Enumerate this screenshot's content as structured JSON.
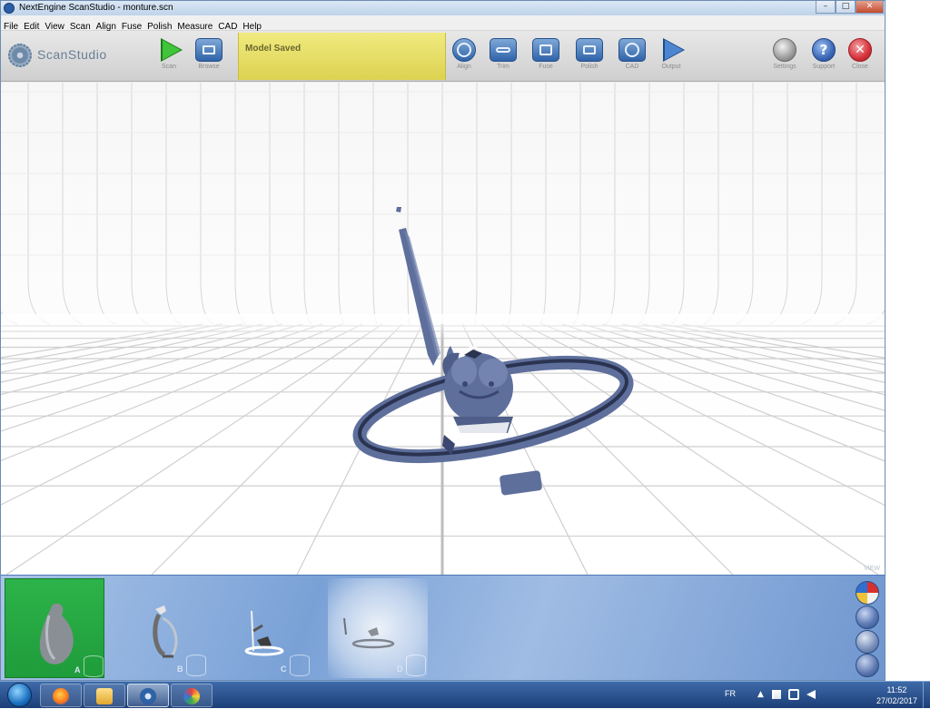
{
  "window": {
    "title": "NextEngine ScanStudio - monture.scn",
    "controls": {
      "minimize": "–",
      "maximize": "□",
      "close": "✕"
    }
  },
  "menubar": {
    "items": [
      "File",
      "Edit",
      "View",
      "Scan",
      "Align",
      "Fuse",
      "Polish",
      "Measure",
      "CAD",
      "Help"
    ]
  },
  "toolbar": {
    "logo_text": "ScanStudio",
    "status_message": "Model Saved",
    "left_buttons": [
      {
        "label": "Scan",
        "icon": "scan-play-icon"
      },
      {
        "label": "Browse",
        "icon": "folder-icon"
      }
    ],
    "mid_buttons": [
      {
        "label": "Align",
        "icon": "align-icon"
      },
      {
        "label": "Trim",
        "icon": "scissors-icon"
      },
      {
        "label": "Fuse",
        "icon": "cube-icon"
      },
      {
        "label": "Polish",
        "icon": "toolbox-icon"
      },
      {
        "label": "CAD",
        "icon": "globe-icon"
      },
      {
        "label": "Output",
        "icon": "output-arrow-icon"
      }
    ],
    "right_buttons": [
      {
        "label": "Settings",
        "icon": "settings-icon",
        "color": "#9b9b9b"
      },
      {
        "label": "Support",
        "icon": "help-icon",
        "color": "#3b67b5"
      },
      {
        "label": "Close",
        "icon": "close-icon",
        "color": "#d6323b"
      }
    ]
  },
  "viewport": {
    "corner_label": "VIEW",
    "model_color": "#5e6f9c"
  },
  "thumbnails": [
    {
      "label": "A",
      "selected": true
    },
    {
      "label": "B",
      "selected": false
    },
    {
      "label": "C",
      "selected": false
    },
    {
      "label": "D",
      "selected": false,
      "highlighted": true
    }
  ],
  "render_modes": [
    "shaded-color-sphere-icon",
    "solid-sphere-icon",
    "textured-sphere-icon",
    "wireframe-sphere-icon"
  ],
  "taskbar": {
    "apps": [
      "firefox-icon",
      "explorer-icon",
      "scanstudio-icon",
      "paint-icon"
    ],
    "language": "FR",
    "time": "11:52",
    "date": "27/02/2017"
  }
}
